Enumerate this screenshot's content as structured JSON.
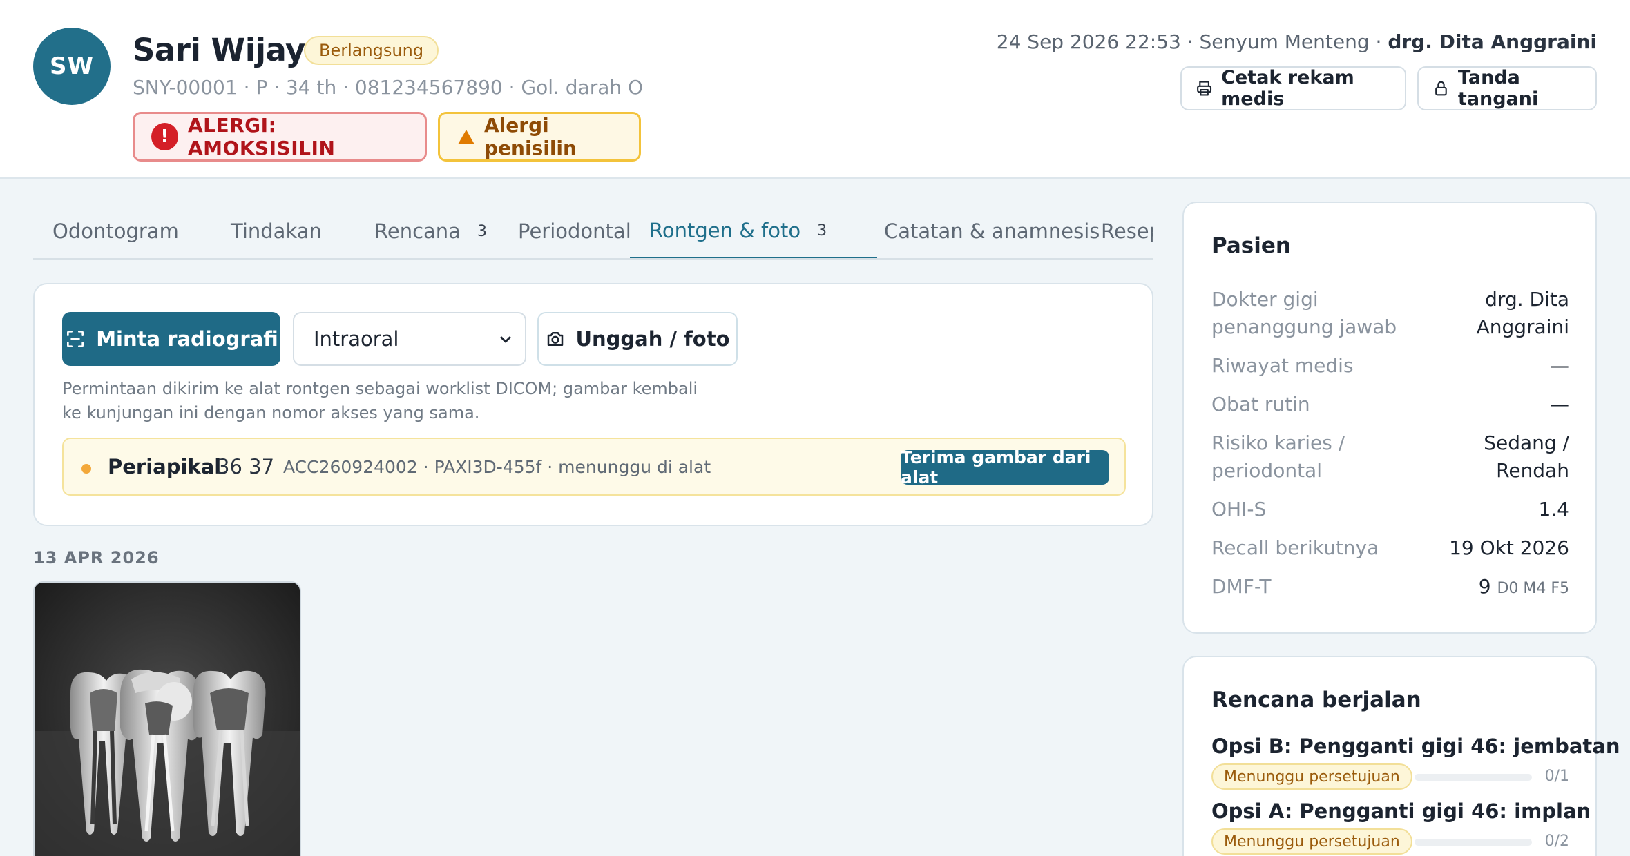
{
  "patient": {
    "initials": "SW",
    "name": "Sari Wijaya",
    "status": "Berlangsung",
    "meta": "SNY-00001 · P · 34 th · 081234567890 · Gol. darah O",
    "alert_primary": "ALERGI: AMOKSISILIN",
    "alert_secondary": "Alergi penisilin"
  },
  "visit": {
    "datetime_clinic": "24 Sep 2026 22:53 · Senyum Menteng · ",
    "doctor": "drg. Dita Anggraini"
  },
  "header_actions": {
    "print_label": "Cetak rekam medis",
    "sign_label": "Tanda tangani"
  },
  "tabs": [
    {
      "label": "Odontogram",
      "count": ""
    },
    {
      "label": "Tindakan",
      "count": ""
    },
    {
      "label": "Rencana",
      "count": "3"
    },
    {
      "label": "Periodontal",
      "count": ""
    },
    {
      "label": "Rontgen & foto",
      "count": "3"
    },
    {
      "label": "Catatan & anamnesis",
      "count": ""
    },
    {
      "label": "Resep",
      "count": ""
    }
  ],
  "active_tab": "Rontgen & foto",
  "radiography": {
    "request_button": "Minta radiografi",
    "modality_selected": "Intraoral",
    "upload_button": "Unggah / foto",
    "help_text": "Permintaan dikirim ke alat rontgen sebagai worklist DICOM; gambar kembali ke kunjungan ini dengan nomor akses yang sama.",
    "worklist": {
      "type": "Periapikal",
      "teeth": "36 37",
      "accession": "ACC260924002 · PAXI3D-455f · menunggu di alat",
      "action": "Terima gambar dari alat"
    }
  },
  "gallery": {
    "date_label": "13 APR 2026"
  },
  "patient_card": {
    "title": "Pasien",
    "rows": [
      {
        "label": "Dokter gigi penanggung jawab",
        "value": "drg. Dita Anggraini"
      },
      {
        "label": "Riwayat medis",
        "value": "—"
      },
      {
        "label": "Obat rutin",
        "value": "—"
      },
      {
        "label": "Risiko karies / periodontal",
        "value": "Sedang / Rendah"
      },
      {
        "label": "OHI-S",
        "value": "1.4"
      },
      {
        "label": "Recall berikutnya",
        "value": "19 Okt 2026"
      },
      {
        "label": "DMF-T",
        "value": "9",
        "detail": "D0 M4 F5"
      }
    ]
  },
  "plans_card": {
    "title": "Rencana berjalan",
    "plans": [
      {
        "title": "Opsi B: Pengganti gigi 46: jembatan",
        "status": "Menunggu persetujuan",
        "progress": 0,
        "count": "0/1"
      },
      {
        "title": "Opsi A: Pengganti gigi 46: implan",
        "status": "Menunggu persetujuan",
        "progress": 0,
        "count": "0/2"
      }
    ]
  },
  "colors": {
    "brand": "#1f6a86",
    "alert_red": "#d41f27",
    "alert_amber": "#e07b00",
    "page_bg": "#f0f5f8"
  },
  "icons": [
    "printer-icon",
    "lock-icon",
    "scan-icon",
    "camera-icon",
    "chevron-down-icon",
    "exclamation-icon",
    "warning-triangle-icon"
  ]
}
